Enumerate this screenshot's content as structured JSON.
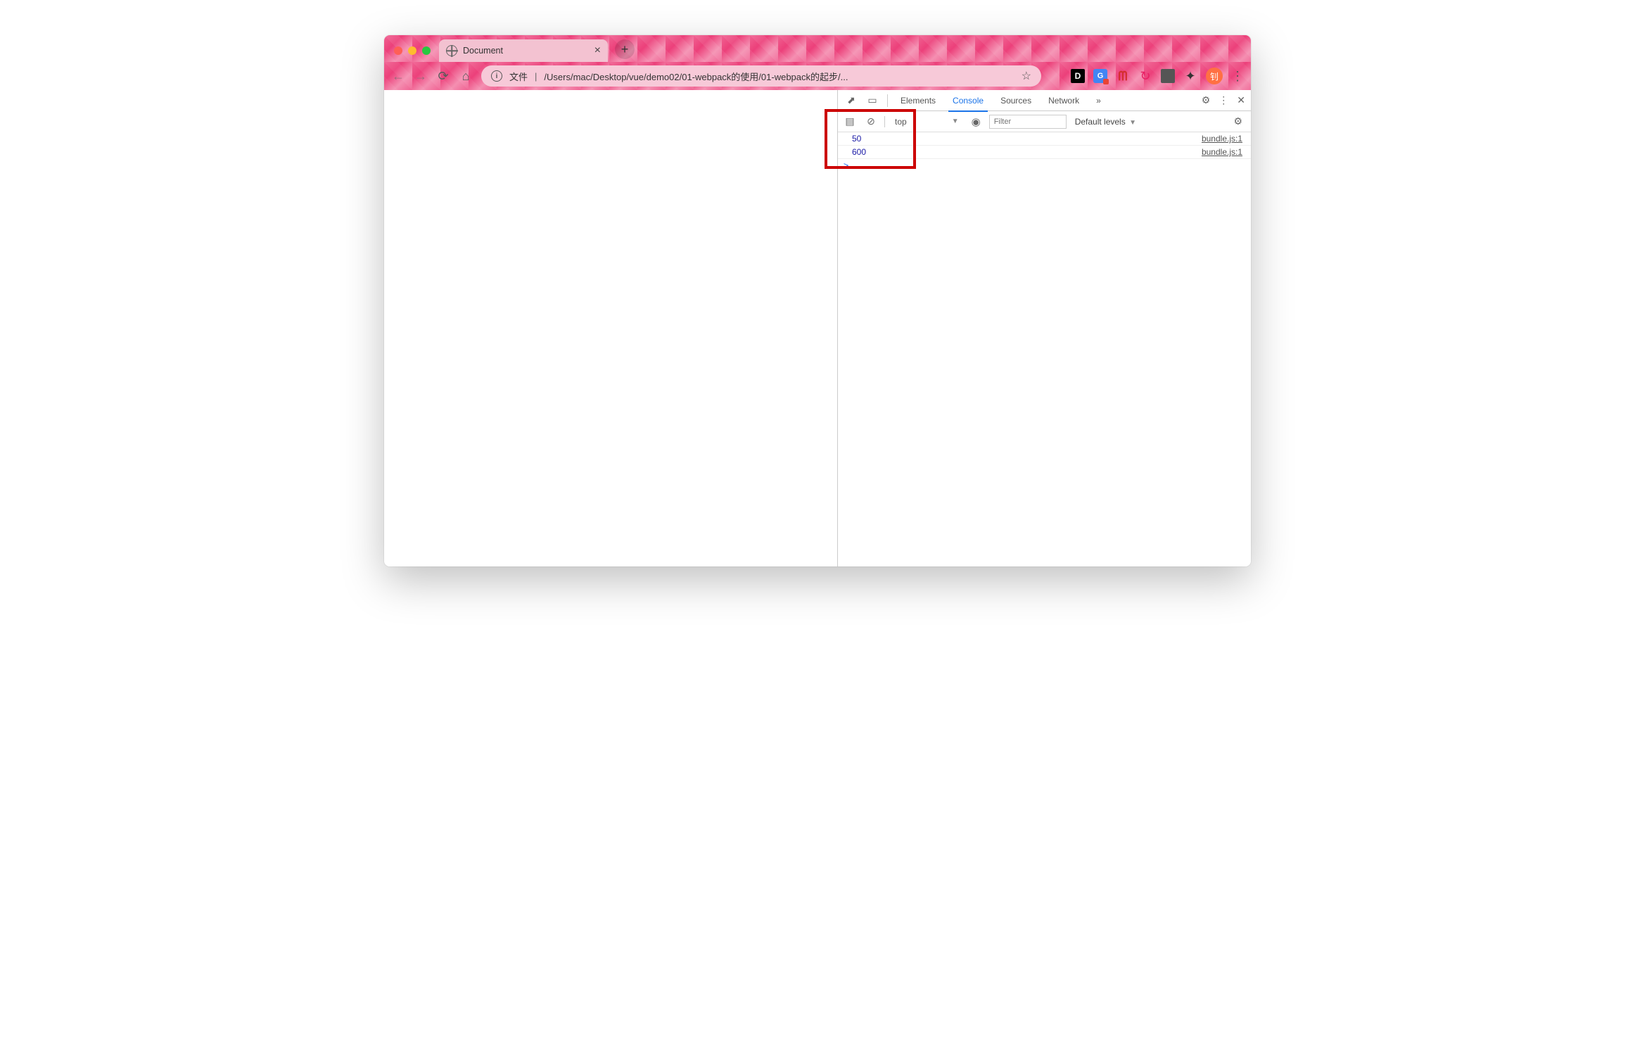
{
  "tab": {
    "title": "Document"
  },
  "address": {
    "scheme_label": "文件",
    "path": "/Users/mac/Desktop/vue/demo02/01-webpack的使用/01-webpack的起步/..."
  },
  "devtools": {
    "tabs": {
      "elements": "Elements",
      "console": "Console",
      "sources": "Sources",
      "network": "Network",
      "more": "»"
    },
    "filter": {
      "context": "top",
      "placeholder": "Filter",
      "levels": "Default levels"
    },
    "logs": [
      {
        "value": "50",
        "source": "bundle.js:1"
      },
      {
        "value": "600",
        "source": "bundle.js:1"
      }
    ],
    "prompt": ">"
  },
  "avatar_initial": "钊"
}
